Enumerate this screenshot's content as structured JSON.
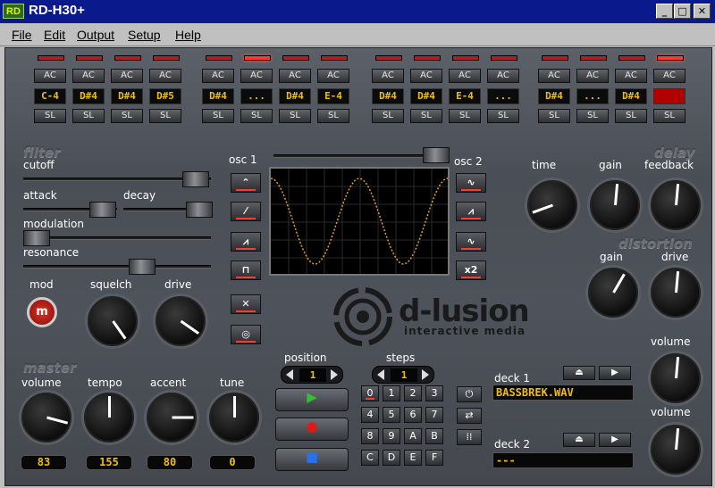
{
  "window": {
    "icon_text": "RD",
    "title": "RD-H30+",
    "min": "_",
    "max": "□",
    "close": "✕"
  },
  "menu": [
    "File",
    "Edit",
    "Output",
    "Setup",
    "Help"
  ],
  "tracks": {
    "ac_label": "AC",
    "sl_label": "SL",
    "notes": [
      "C-4",
      "D#4",
      "D#4",
      "D#5",
      "D#4",
      "...",
      "D#4",
      "E-4",
      "D#4",
      "D#4",
      "E-4",
      "...",
      "D#4",
      "...",
      "D#4",
      ""
    ],
    "led_states": [
      "off",
      "off",
      "off",
      "off",
      "off",
      "on",
      "off",
      "off",
      "off",
      "off",
      "off",
      "off",
      "off",
      "off",
      "off",
      "on"
    ]
  },
  "filter": {
    "title": "filter",
    "cutoff": "cutoff",
    "attack": "attack",
    "decay": "decay",
    "modulation": "modulation",
    "resonance": "resonance",
    "mod": "mod",
    "mod_button": "m",
    "squelch": "squelch",
    "drive": "drive"
  },
  "osc": {
    "osc1": "osc 1",
    "osc2": "osc 2",
    "x2_label": "x2"
  },
  "delay": {
    "title": "delay",
    "time": "time",
    "gain": "gain",
    "feedback": "feedback"
  },
  "distortion": {
    "title": "distortion",
    "gain": "gain",
    "drive": "drive",
    "volume": "volume"
  },
  "master": {
    "title": "master",
    "volume": "volume",
    "tempo": "tempo",
    "accent": "accent",
    "tune": "tune",
    "values": [
      "83",
      "155",
      "80",
      "0"
    ]
  },
  "sequencer": {
    "position_label": "position",
    "position_value": "1",
    "steps_label": "steps",
    "steps_value": "1",
    "keys": [
      "0",
      "1",
      "2",
      "3",
      "4",
      "5",
      "6",
      "7",
      "8",
      "9",
      "A",
      "B",
      "C",
      "D",
      "E",
      "F"
    ]
  },
  "logo": {
    "name": "d-lusion",
    "tagline": "interactive media"
  },
  "decks": {
    "deck1_label": "deck 1",
    "deck1_file": "BASSBREK.WAV",
    "deck2_label": "deck 2",
    "deck2_file": "---",
    "volume": "volume"
  },
  "colors": {
    "accent": "#ff3a2a",
    "lcd_text": "#f0c000",
    "titlebar": "#0a1a8c"
  }
}
